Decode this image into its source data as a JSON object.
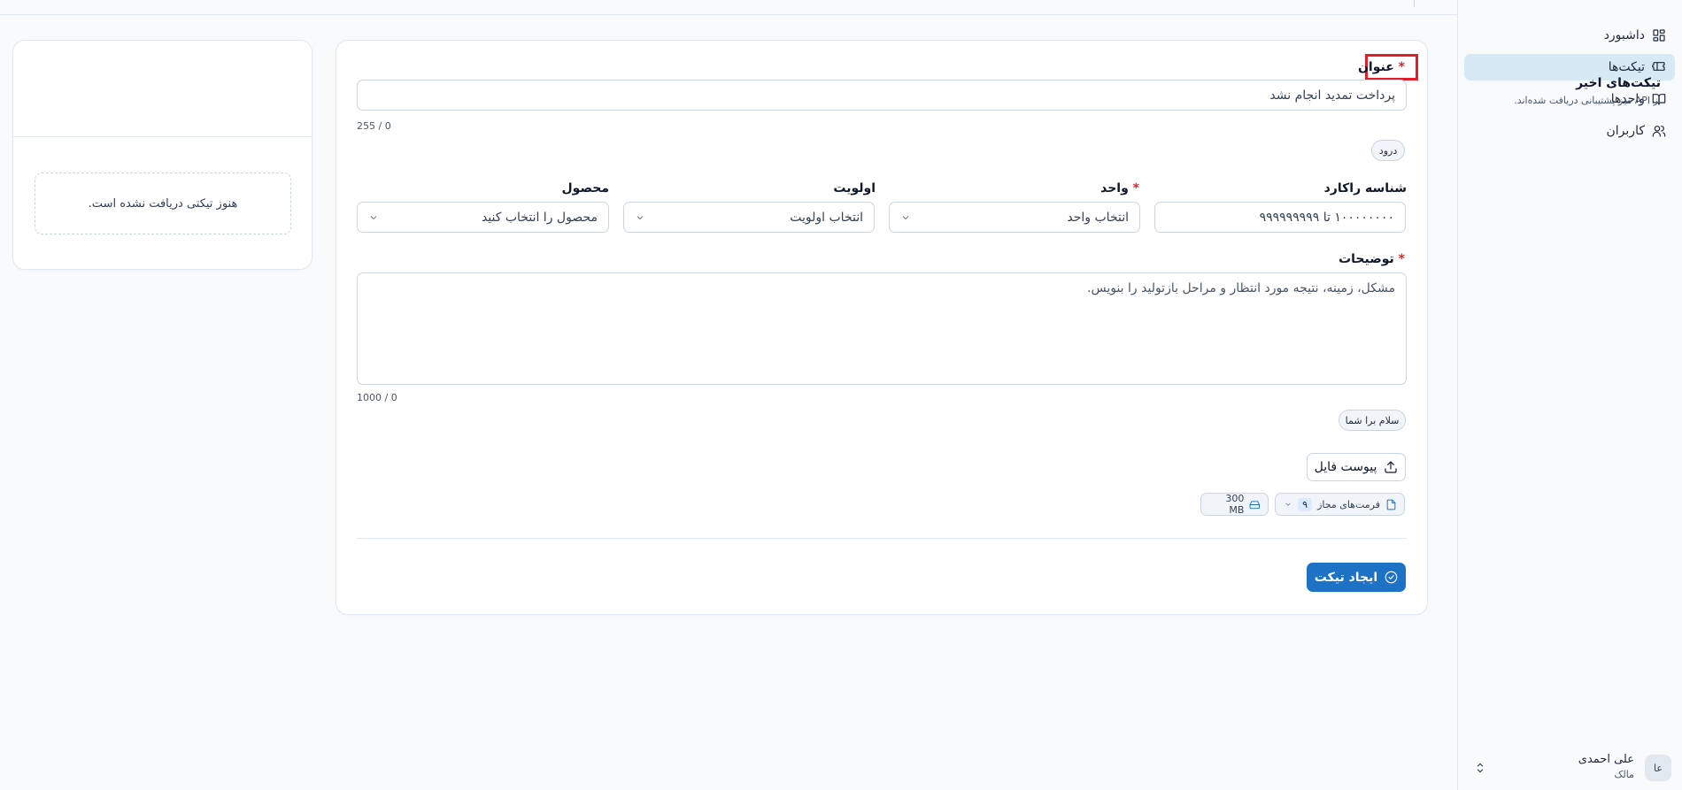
{
  "sidebar": {
    "items": [
      {
        "label": "داشبورد",
        "icon": "dashboard-icon",
        "active": false
      },
      {
        "label": "تیکت‌ها",
        "icon": "ticket-icon",
        "active": true
      },
      {
        "label": "واحدها",
        "icon": "book-icon",
        "active": false
      },
      {
        "label": "کاربران",
        "icon": "users-icon",
        "active": false
      }
    ],
    "user": {
      "initials": "عا",
      "name": "علی احمدی",
      "role": "مالک"
    }
  },
  "form": {
    "title": {
      "label": "عنوان",
      "value": "پرداخت تمدید انجام نشد",
      "counter": "255 / 0",
      "chip": "درود"
    },
    "racard": {
      "label": "شناسه راکارد",
      "placeholder": "۱۰۰۰۰۰۰۰۰ تا ۹۹۹۹۹۹۹۹۹"
    },
    "unit": {
      "label": "واحد",
      "value": "انتخاب واحد"
    },
    "priority": {
      "label": "اولویت",
      "value": "انتخاب اولویت"
    },
    "product": {
      "label": "محصول",
      "value": "محصول را انتخاب کنید"
    },
    "description": {
      "label": "توضیحات",
      "placeholder": "مشکل، زمینه، نتیجه مورد انتظار و مراحل بازتولید را بنویس.",
      "counter": "1000 / 0",
      "chip": "سلام برا شما"
    },
    "attach_label": "پیوست فایل",
    "formats": {
      "label": "فرمت‌های مجاز",
      "count": "۹"
    },
    "max_size": "300 MB",
    "submit_label": "ایجاد تیکت",
    "required_mark": "*"
  },
  "recent": {
    "title": "تیکت‌های اخیر",
    "subtitle": "از API میز پشتیبانی دریافت شده‌اند.",
    "empty": "هنوز تیکتی دریافت نشده است."
  },
  "colors": {
    "accent": "#1d72c6",
    "active_nav": "#d6e9f5",
    "required": "#dc2626",
    "highlight": "#e11d2a"
  }
}
